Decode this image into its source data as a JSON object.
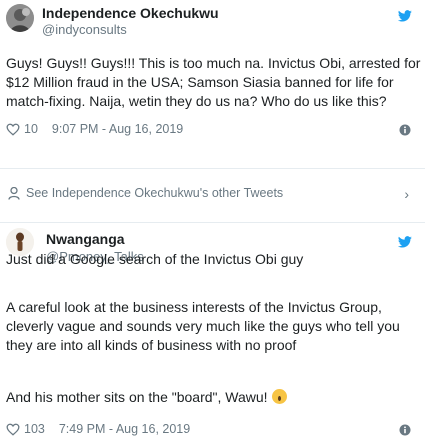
{
  "tweet1": {
    "name": "Independence Okechukwu",
    "handle": "@indyconsults",
    "text": "Guys! Guys!! Guys!!! This is too much na. Invictus Obi, arrested for $12 Million fraud in the USA; Samson Siasia banned for life for match-fixing. Naija, wetin they do us na? Who do us like this?",
    "likes": "10",
    "timestamp": "9:07 PM - Aug 16, 2019",
    "see_more": "See Independence Okechukwu's other Tweets"
  },
  "tweet2": {
    "name": "Nwanganga",
    "handle": "@Pmoney_Talks",
    "para1": "Just did a Google search of the Invictus Obi guy",
    "para2": "A careful look at the business interests of the Invictus Group, cleverly vague and sounds very much like the guys who tell you they are into all kinds of business with no proof",
    "para3": "And his mother sits on the \"board\", Wawu!",
    "likes": "103",
    "timestamp": "7:49 PM - Aug 16, 2019"
  },
  "colors": {
    "twitter_blue": "#1da1f2",
    "muted": "#697882",
    "text": "#1c2022",
    "divider": "#e6ecf0"
  },
  "icons": [
    "twitter-bird-icon",
    "heart-icon",
    "info-icon",
    "person-icon",
    "chevron-right-icon",
    "shocked-emoji-icon"
  ]
}
